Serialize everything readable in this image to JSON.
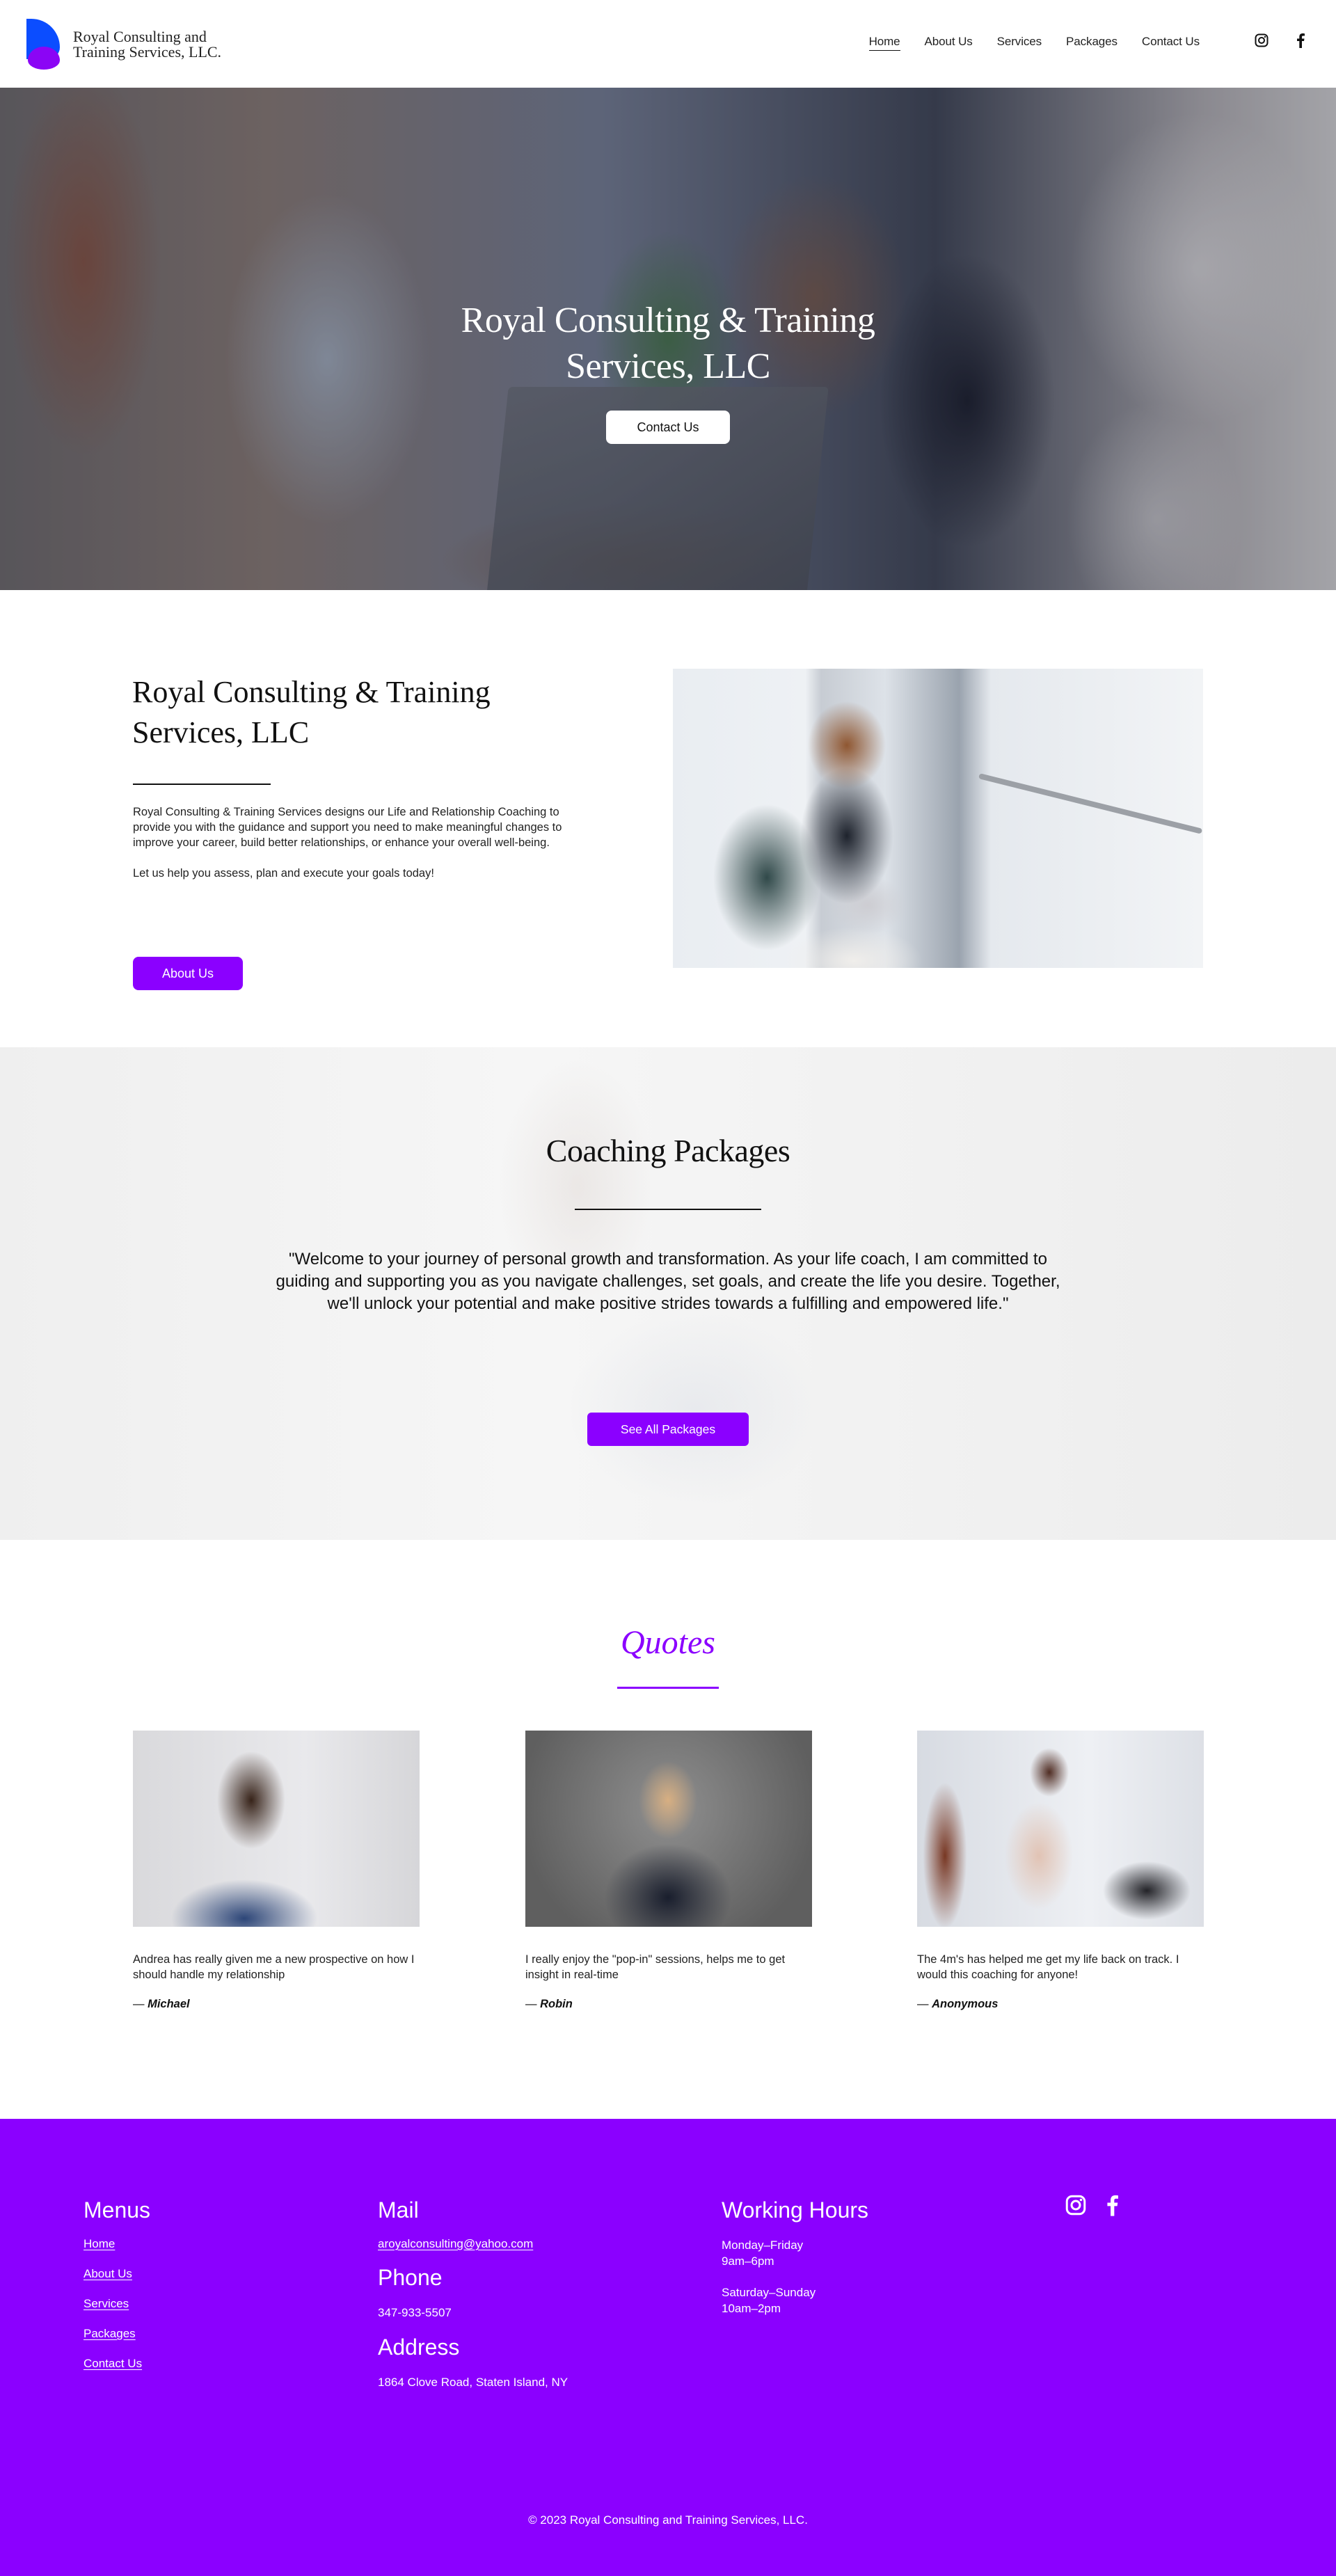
{
  "header": {
    "logo": {
      "line1": "Royal Consulting and",
      "line2": "Training Services, LLC."
    },
    "nav": [
      {
        "label": "Home",
        "active": true
      },
      {
        "label": "About Us",
        "active": false
      },
      {
        "label": "Services",
        "active": false
      },
      {
        "label": "Packages",
        "active": false
      },
      {
        "label": "Contact Us",
        "active": false
      }
    ],
    "socials": [
      {
        "name": "instagram-icon"
      },
      {
        "name": "facebook-icon"
      }
    ]
  },
  "hero": {
    "title_line1": "Royal Consulting & Training",
    "title_line2": "Services, LLC",
    "button": "Contact Us"
  },
  "about": {
    "title_line1": "Royal Consulting & Training",
    "title_line2": "Services, LLC",
    "paragraph1": "Royal Consulting & Training Services designs our Life and Relationship Coaching to provide you with the guidance and support you need to make meaningful changes to improve your career, build better relationships, or enhance your overall well-being.",
    "paragraph2": "Let us help you assess, plan and execute your goals today!",
    "button": "About Us",
    "image_alt": "Woman working on a laptop by a window"
  },
  "coaching": {
    "title": "Coaching Packages",
    "quote": "\"Welcome to your journey of personal growth and transformation. As your life coach, I am committed to guiding and supporting you as you navigate challenges, set goals, and create the life you desire. Together, we'll unlock your potential and make positive strides towards a fulfilling and empowered life.\"",
    "button": "See All Packages"
  },
  "quotes": {
    "title": "Quotes",
    "items": [
      {
        "text": "Andrea has really given me a new prospective on how I should handle my relationship",
        "dash": "— ",
        "author": "Michael"
      },
      {
        "text": "I really enjoy the \"pop-in\" sessions, helps me to get insight in real-time",
        "dash": "— ",
        "author": "Robin"
      },
      {
        "text": "The 4m's has helped me get my life back on track. I would this coaching for anyone!",
        "dash": "— ",
        "author": "Anonymous"
      }
    ]
  },
  "footer": {
    "menus": {
      "heading": "Menus",
      "links": [
        "Home",
        "About Us",
        "Services",
        "Packages",
        "Contact Us"
      ]
    },
    "mail": {
      "heading": "Mail",
      "email": "aroyalconsulting@yahoo.com"
    },
    "phone": {
      "heading": "Phone",
      "number": "347-933-5507"
    },
    "address": {
      "heading": "Address",
      "value": "1864 Clove Road, Staten Island, NY"
    },
    "hours": {
      "heading": "Working Hours",
      "weekday_days": "Monday–Friday",
      "weekday_hours": "9am–6pm",
      "weekend_days": "Saturday–Sunday",
      "weekend_hours": "10am–2pm"
    },
    "copyright": "© 2023 Royal Consulting and Training Services, LLC."
  },
  "colors": {
    "brand_purple": "#8b00ff",
    "logo_blue": "#0b4dff",
    "text": "#111111",
    "white": "#ffffff"
  }
}
